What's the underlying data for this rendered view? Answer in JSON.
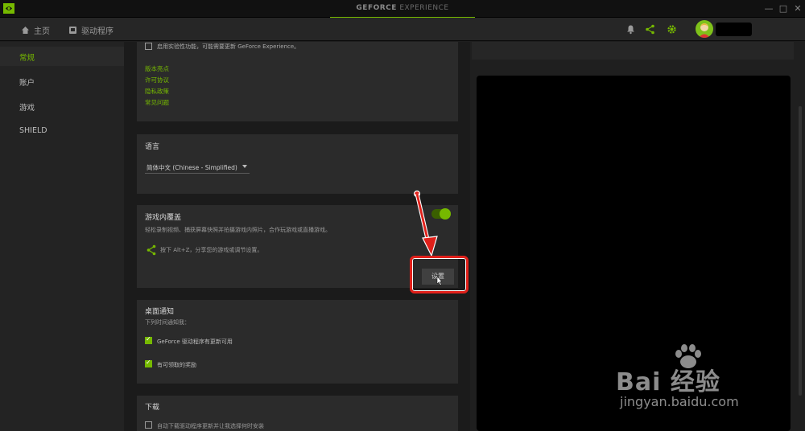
{
  "titlebar": {
    "brand_main": "GEFORCE",
    "brand_sub": " EXPERIENCE",
    "minimize": "—",
    "maximize": "□",
    "close": "✕"
  },
  "nav": {
    "home": "主页",
    "drivers": "驱动程序"
  },
  "sidebar": {
    "items": [
      {
        "label": "常规",
        "active": true
      },
      {
        "label": "账户",
        "active": false
      },
      {
        "label": "游戏",
        "active": false
      },
      {
        "label": "SHIELD",
        "active": false
      }
    ]
  },
  "general": {
    "experimental_label": "启用实验性功能，可能需要更新 GeForce Experience。",
    "links": [
      "版本亮点",
      "许可协议",
      "隐私政策",
      "常见问题"
    ]
  },
  "language": {
    "title": "语言",
    "selected": "简体中文 (Chinese - Simplified)"
  },
  "overlay": {
    "title": "游戏内覆盖",
    "description": "轻松录制视频、捕获屏幕快照并拍摄游戏内照片，合作玩游戏或直播游戏。",
    "hint": "按下 Alt+Z，分享您的游戏或调节设置。",
    "settings_button": "设置",
    "enabled": true
  },
  "desktop_notifications": {
    "title": "桌面通知",
    "subtitle": "下列时间通知我：",
    "options": [
      {
        "label": "GeForce 驱动程序有更新可用",
        "checked": true
      },
      {
        "label": "有可领取的奖励",
        "checked": true
      }
    ]
  },
  "download": {
    "title": "下载",
    "option": "自动下载驱动程序更新并让我选择何时安装"
  },
  "watermark": {
    "brand": "Bai 经验",
    "url": "jingyan.baidu.com"
  },
  "colors": {
    "accent": "#76b900",
    "annotation": "#e0201a"
  }
}
